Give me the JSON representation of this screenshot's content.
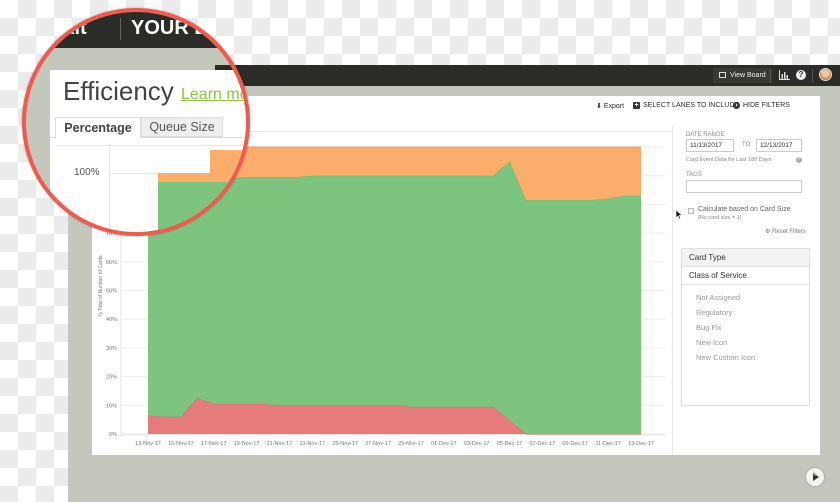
{
  "topbar": {
    "view_board": "View Board",
    "icons": [
      "board-icon",
      "chart-icon",
      "help-icon",
      "avatar"
    ]
  },
  "toolbar": {
    "export": "Export",
    "select_lanes": "SELECT LANES TO INCLUDE",
    "hide_filters": "HIDE FILTERS"
  },
  "filters": {
    "date_range_label": "DATE RANGE",
    "from": "11/13/2017",
    "to_label": "TO",
    "to": "12/13/2017",
    "note": "Card Event Data for Last 180 Days",
    "tags_label": "TAGS",
    "tags_value": "",
    "card_size_label": "Calculate based on Card Size",
    "card_size_note": "(No card size = 1)",
    "card_size_checked": false,
    "reset": "Reset Filters",
    "card_type": "Card Type",
    "class_of_service": "Class of Service",
    "items": [
      "Not Assigned",
      "Regulatory",
      "Bug Fix",
      "New Icon",
      "New Custom Icon"
    ]
  },
  "magnifier": {
    "brand": "ankit",
    "board": "YOUR B",
    "title": "Efficiency",
    "learn_more": "Learn mo",
    "tabs": [
      "Percentage",
      "Queue Size"
    ],
    "active_tab": "Percentage",
    "tick": "100%",
    "border_color": "#f15a4f"
  },
  "chart_data": {
    "type": "area",
    "stacked": true,
    "ylabel": "% Total of Number of Cards",
    "ylim": [
      0,
      100
    ],
    "yticks": [
      "0%",
      "10%",
      "20%",
      "30%",
      "40%",
      "50%",
      "60%",
      "70%",
      "80%",
      "90%",
      "100%"
    ],
    "x": [
      "13-Nov-17",
      "14-Nov-17",
      "15-Nov-17",
      "16-Nov-17",
      "17-Nov-17",
      "18-Nov-17",
      "19-Nov-17",
      "20-Nov-17",
      "21-Nov-17",
      "22-Nov-17",
      "23-Nov-17",
      "24-Nov-17",
      "25-Nov-17",
      "26-Nov-17",
      "27-Nov-17",
      "28-Nov-17",
      "29-Nov-17",
      "30-Nov-17",
      "01-Dec-17",
      "02-Dec-17",
      "03-Dec-17",
      "04-Dec-17",
      "05-Dec-17",
      "06-Dec-17",
      "07-Dec-17",
      "08-Dec-17",
      "09-Dec-17",
      "10-Dec-17",
      "11-Dec-17",
      "12-Dec-17",
      "13-Dec-17"
    ],
    "xticks": [
      "13-Nov-17",
      "15-Nov-17",
      "17-Nov-17",
      "19-Nov-17",
      "21-Nov-17",
      "23-Nov-17",
      "25-Nov-17",
      "27-Nov-17",
      "29-Nov-17",
      "01-Dec-17",
      "03-Dec-17",
      "05-Dec-17",
      "07-Dec-17",
      "09-Dec-17",
      "11-Dec-17",
      "13-Dec-17"
    ],
    "series": [
      {
        "color": "#e67b7b",
        "values": [
          6.5,
          6,
          6,
          12.5,
          10.5,
          10.5,
          10.5,
          10.5,
          10,
          10,
          10,
          10,
          10,
          10,
          10,
          10,
          9.5,
          9.5,
          9.5,
          9.5,
          9.5,
          9.5,
          4.7,
          0,
          0,
          0,
          0,
          0,
          0,
          0,
          0
        ]
      },
      {
        "color": "#7dc47e",
        "values": [
          81.5,
          82,
          82,
          76,
          78.5,
          78.5,
          79,
          79,
          79.5,
          79.5,
          80,
          80,
          80,
          80,
          80,
          80,
          80.5,
          80.5,
          80.5,
          80.5,
          80.5,
          80.5,
          90.3,
          81.5,
          81.5,
          81.5,
          81.5,
          81.5,
          82,
          83,
          83
        ]
      },
      {
        "color": "#fcac6b",
        "values": [
          12,
          12,
          12,
          11.5,
          11,
          11,
          10.5,
          10.5,
          10.5,
          10.5,
          10,
          10,
          10,
          10,
          10,
          10,
          10,
          10,
          10,
          10,
          10,
          10,
          5,
          18.5,
          18.5,
          18.5,
          18.5,
          18.5,
          18,
          17,
          17
        ]
      }
    ],
    "grid": true,
    "legend": "none"
  }
}
